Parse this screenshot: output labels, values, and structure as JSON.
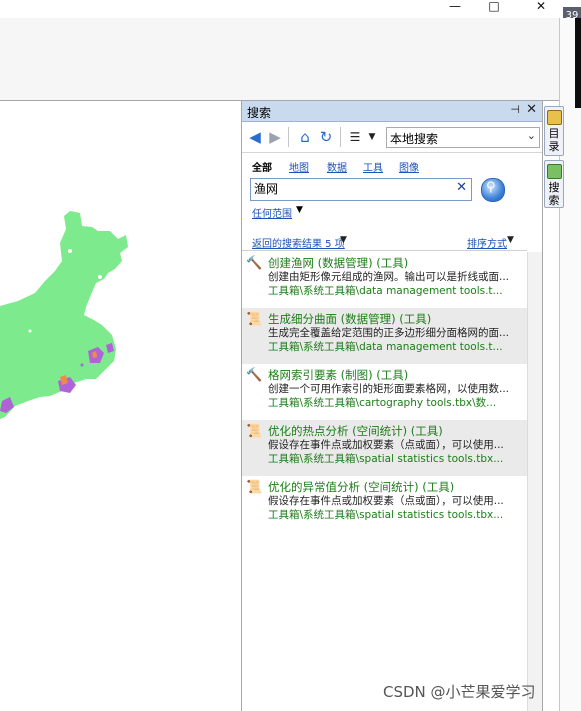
{
  "window": {
    "minimize_glyph": "—",
    "maximize_glyph": "□",
    "close_glyph": "✕",
    "corner_number": "39"
  },
  "search_pane": {
    "title": "搜索",
    "pin_glyph": "⊣",
    "close_glyph": "✕",
    "toolbar": {
      "back_icon": "back-arrow-icon",
      "forward_icon": "forward-arrow-icon",
      "home_icon": "home-icon",
      "refresh_icon": "refresh-icon",
      "options_icon": "list-options-icon",
      "location": "本地搜索"
    },
    "categories": [
      "全部",
      "地图",
      "数据",
      "工具",
      "图像"
    ],
    "search_value": "渔网",
    "scope": "任何范围",
    "results_count_label": "返回的搜索结果 5 项",
    "sort_label": "排序方式",
    "results": [
      {
        "icon": "hammer-tool-icon",
        "title": "创建渔网 (数据管理) (工具)",
        "desc": "创建由矩形像元组成的渔网。输出可以是折线或面...",
        "path": "工具箱\\系统工具箱\\data management tools.t..."
      },
      {
        "icon": "script-tool-icon",
        "title": "生成细分曲面 (数据管理) (工具)",
        "desc": "生成完全覆盖给定范围的正多边形细分面格网的面...",
        "path": "工具箱\\系统工具箱\\data management tools.t..."
      },
      {
        "icon": "hammer-tool-icon",
        "title": "格网索引要素 (制图) (工具)",
        "desc": "创建一个可用作索引的矩形面要素格网，以使用数...",
        "path": "工具箱\\系统工具箱\\cartography tools.tbx\\数..."
      },
      {
        "icon": "script-tool-icon",
        "title": "优化的热点分析 (空间统计) (工具)",
        "desc": "假设存在事件点或加权要素（点或面），可以使用...",
        "path": "工具箱\\系统工具箱\\spatial statistics tools.tbx..."
      },
      {
        "icon": "script-tool-icon",
        "title": "优化的异常值分析 (空间统计) (工具)",
        "desc": "假设存在事件点或加权要素（点或面），可以使用...",
        "path": "工具箱\\系统工具箱\\spatial statistics tools.tbx..."
      }
    ]
  },
  "side_tabs": [
    {
      "label": "目录",
      "icon": "catalog-icon"
    },
    {
      "label": "搜索",
      "icon": "search-tab-icon"
    }
  ],
  "watermark": "CSDN @小芒果爱学习",
  "colors": {
    "land": "#7dea8d",
    "hotspot_purple": "#b063d6",
    "hotspot_orange": "#f08a4b",
    "result_title": "#1e7c19",
    "link": "#1a52b5"
  }
}
